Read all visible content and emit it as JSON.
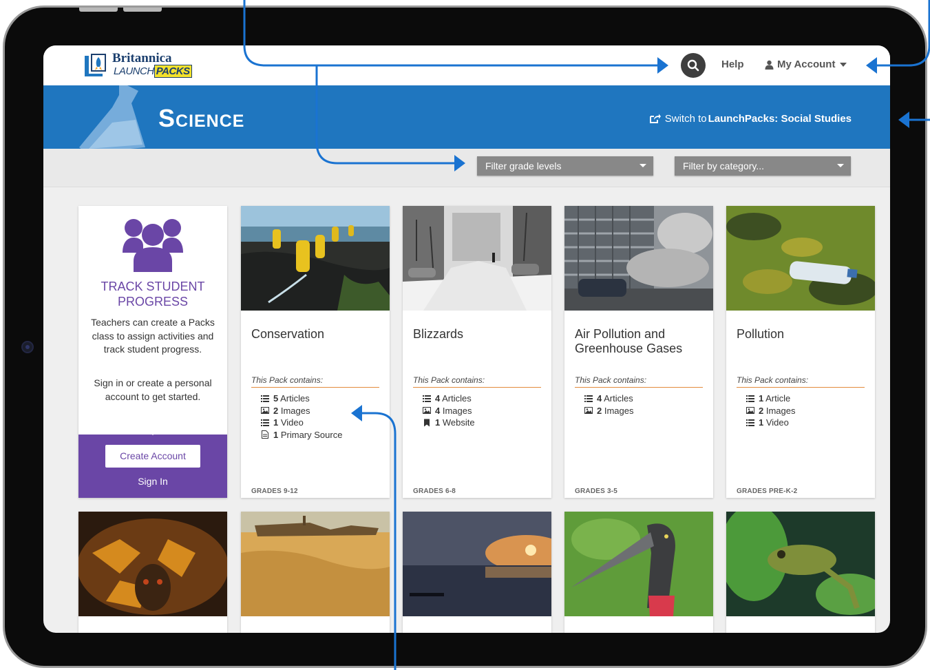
{
  "header": {
    "logo_word1": "Britannica",
    "logo_word2": "LAUNCH",
    "logo_word3": "PACKS",
    "help_label": "Help",
    "account_label": "My Account"
  },
  "banner": {
    "title": "Science",
    "switch_prefix": "Switch to ",
    "switch_target": "LaunchPacks: Social Studies"
  },
  "filters": {
    "grade_placeholder": "Filter grade levels",
    "category_placeholder": "Filter by category..."
  },
  "track": {
    "title": "TRACK STUDENT PROGRESS",
    "text1": "Teachers can create a Packs class to assign activities and track student progress.",
    "text2": "Sign in or create a personal account to get started.",
    "create_label": "Create Account",
    "signin_label": "Sign In"
  },
  "contains_label": "This Pack contains:",
  "packs": [
    {
      "title": "Conservation",
      "grades": "GRADES 9-12",
      "items": [
        {
          "icon": "list-icon",
          "count": "5",
          "label": "Articles"
        },
        {
          "icon": "image-icon",
          "count": "2",
          "label": "Images"
        },
        {
          "icon": "list-icon",
          "count": "1",
          "label": "Video"
        },
        {
          "icon": "document-icon",
          "count": "1",
          "label": "Primary Source"
        }
      ]
    },
    {
      "title": "Blizzards",
      "grades": "GRADES 6-8",
      "items": [
        {
          "icon": "list-icon",
          "count": "4",
          "label": "Articles"
        },
        {
          "icon": "image-icon",
          "count": "4",
          "label": "Images"
        },
        {
          "icon": "bookmark-icon",
          "count": "1",
          "label": "Website"
        }
      ]
    },
    {
      "title": "Air Pollution and Greenhouse Gases",
      "grades": "GRADES 3-5",
      "items": [
        {
          "icon": "list-icon",
          "count": "4",
          "label": "Articles"
        },
        {
          "icon": "image-icon",
          "count": "2",
          "label": "Images"
        }
      ]
    },
    {
      "title": "Pollution",
      "grades": "GRADES PRE-K-2",
      "items": [
        {
          "icon": "list-icon",
          "count": "1",
          "label": "Article"
        },
        {
          "icon": "image-icon",
          "count": "2",
          "label": "Images"
        },
        {
          "icon": "list-icon",
          "count": "1",
          "label": "Video"
        }
      ]
    }
  ],
  "colors": {
    "brand_blue": "#1f76bf",
    "track_purple": "#6a46a6",
    "accent_orange": "#e38a3b",
    "annotation_arrow": "#1a73d1"
  }
}
